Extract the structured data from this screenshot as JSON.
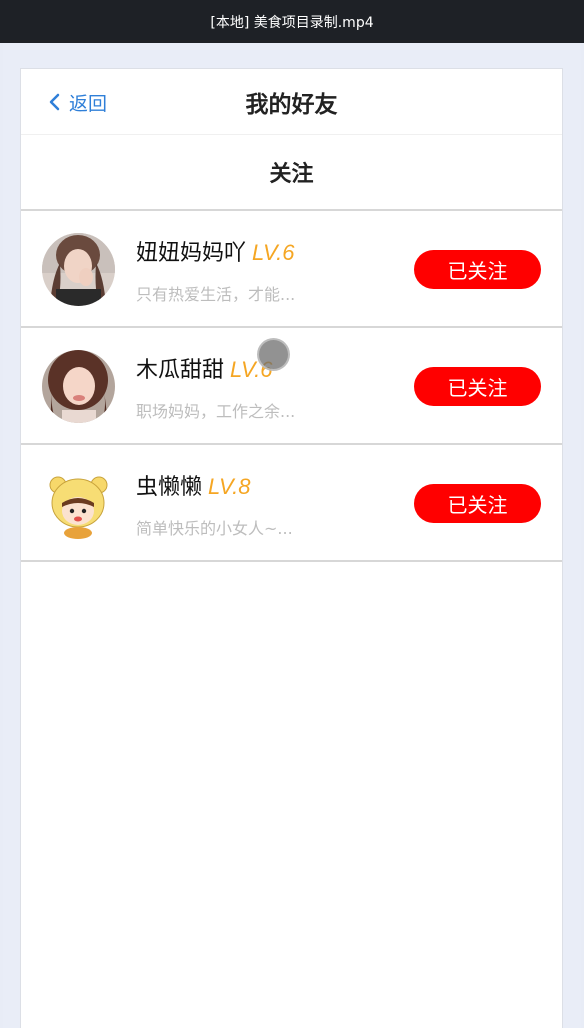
{
  "window": {
    "title": "[本地] 美食项目录制.mp4"
  },
  "navbar": {
    "back_label": "返回",
    "title": "我的好友"
  },
  "section": {
    "title": "关注"
  },
  "friends": [
    {
      "name": "妞妞妈妈吖",
      "level": "LV.6",
      "desc": "只有热爱生活，才能...",
      "button": "已关注",
      "avatar": "woman-photo-avatar"
    },
    {
      "name": "木瓜甜甜",
      "level": "LV.6",
      "desc": "职场妈妈，工作之余...",
      "button": "已关注",
      "avatar": "woman-portrait-avatar"
    },
    {
      "name": "虫懒懒",
      "level": "LV.8",
      "desc": "简单快乐的小女人~...",
      "button": "已关注",
      "avatar": "cartoon-bear-avatar"
    }
  ],
  "colors": {
    "accent": "#2f7fd8",
    "button": "#ff0000",
    "level": "#f5a623"
  }
}
